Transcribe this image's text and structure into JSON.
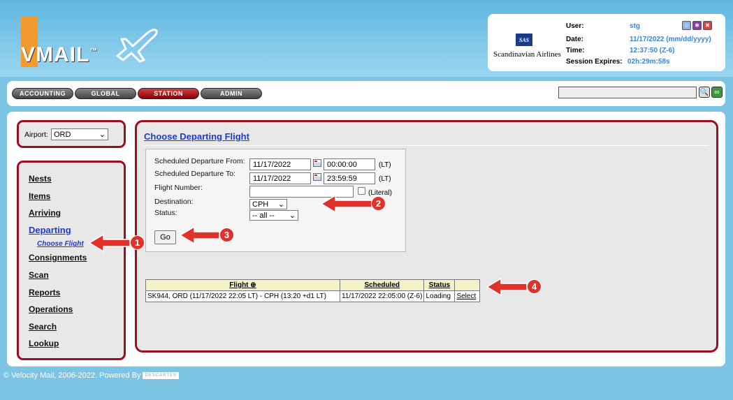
{
  "brand": {
    "logo": "VMAIL",
    "tm": "™"
  },
  "session": {
    "airline_code": "SAS",
    "airline": "Scandinavian Airlines",
    "user_label": "User:",
    "user": "stg",
    "date_label": "Date:",
    "date": "11/17/2022 (mm/dd/yyyy)",
    "time_label": "Time:",
    "time": "12:37:50 (Z-6)",
    "expires_label": "Session Expires:",
    "expires": "02h:29m:58s"
  },
  "tabs": [
    "ACCOUNTING",
    "GLOBAL",
    "STATION",
    "ADMIN"
  ],
  "airport": {
    "label": "Airport:",
    "value": "ORD"
  },
  "nav": {
    "items": [
      "Nests",
      "Items",
      "Arriving",
      "Departing",
      "Consignments",
      "Scan",
      "Reports",
      "Operations",
      "Search",
      "Lookup"
    ],
    "sub": "Choose Flight"
  },
  "page": {
    "title": "Choose Departing Flight"
  },
  "form": {
    "from_label": "Scheduled Departure From:",
    "from_date": "11/17/2022",
    "from_time": "00:00:00",
    "to_label": "Scheduled Departure To:",
    "to_date": "11/17/2022",
    "to_time": "23:59:59",
    "lt": "(LT)",
    "flight_label": "Flight Number:",
    "literal": "(Literal)",
    "dest_label": "Destination:",
    "dest": "CPH",
    "status_label": "Status:",
    "status": "-- all --",
    "go": "Go"
  },
  "table": {
    "headers": [
      "Flight",
      "Scheduled",
      "Status",
      ""
    ],
    "row": [
      "SK944, ORD (11/17/2022 22:05 LT) - CPH (13:20 +d1 LT)",
      "11/17/2022 22:05:00 (Z-6)",
      "Loading",
      "Select"
    ]
  },
  "callouts": [
    "1",
    "2",
    "3",
    "4"
  ],
  "footer": {
    "text": "© Velocity Mail, 2006-2022. Powered By",
    "partner": "DESCARTES"
  },
  "colors": {
    "accent": "#9b1020",
    "link": "#1a3bd6",
    "annotation": "#e0322a"
  }
}
